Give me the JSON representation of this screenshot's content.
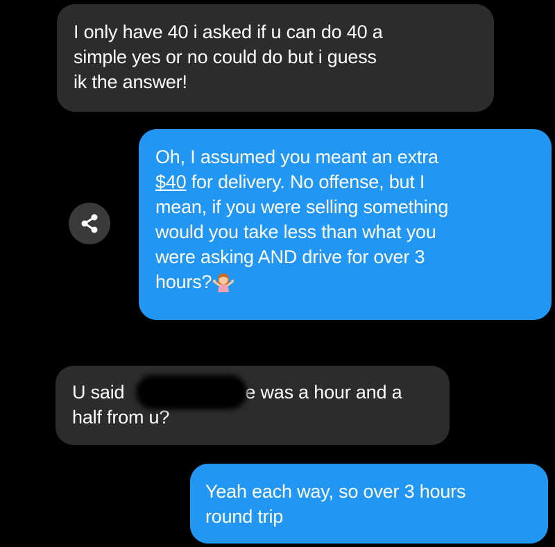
{
  "messages": [
    {
      "direction": "incoming",
      "lines": [
        "I only have 40 i asked if u can do 40 a",
        "simple yes or no could do but i guess",
        "ik the answer!"
      ]
    },
    {
      "direction": "outgoing",
      "line1": "Oh, I assumed you meant an extra",
      "line2_money": "$40",
      "line2_rest": " for delivery. No offense, but I",
      "line3": "mean, if you were selling something",
      "line4": "would you take less than what you",
      "line5": "were asking AND drive for over 3",
      "line6": "hours?",
      "emoji": "person-shrugging-emoji"
    },
    {
      "direction": "incoming",
      "line1_start": "U said",
      "line1_end": "e was a hour and a",
      "line2": "half from u?"
    },
    {
      "direction": "outgoing",
      "lines": [
        "Yeah each way, so over 3 hours",
        "round trip"
      ]
    }
  ],
  "colors": {
    "background": "#000000",
    "incoming_bubble": "#2c2c2e",
    "outgoing_bubble": "#2196f3",
    "text": "#ffffff",
    "share_button": "#3a3a3c"
  },
  "icons": {
    "share": "share-icon"
  }
}
